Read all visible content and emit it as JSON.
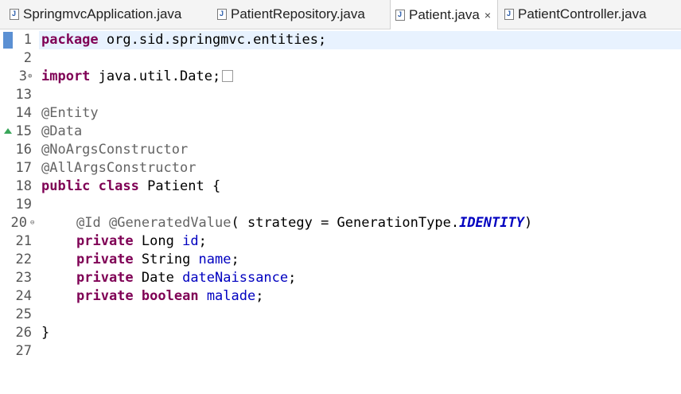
{
  "tabs": [
    {
      "label": "SpringmvcApplication.java",
      "active": false
    },
    {
      "label": "PatientRepository.java",
      "active": false
    },
    {
      "label": "Patient.java",
      "active": true
    },
    {
      "label": "PatientController.java",
      "active": false
    }
  ],
  "tab_close_glyph": "×",
  "icons": {
    "file": "java-file-icon",
    "close": "close-icon",
    "fold": "fold-toggle-icon",
    "warning": "warning-marker-icon"
  },
  "colors": {
    "keyword": "#7f0055",
    "annotation": "#646464",
    "field": "#0000c0",
    "current_line": "#e8f2fe"
  },
  "editor": {
    "line_numbers": [
      "1",
      "2",
      "3",
      "13",
      "14",
      "15",
      "16",
      "17",
      "18",
      "19",
      "20",
      "21",
      "22",
      "23",
      "24",
      "25",
      "26",
      "27"
    ],
    "lines": {
      "l1": {
        "kw": "package",
        "rest": " org.sid.springmvc.entities;"
      },
      "l3": {
        "kw": "import",
        "rest": " java.util.Date;"
      },
      "l14": {
        "ann": "@Entity"
      },
      "l15": {
        "ann": "@Data"
      },
      "l16": {
        "ann": "@NoArgsConstructor"
      },
      "l17": {
        "ann": "@AllArgsConstructor"
      },
      "l18": {
        "kw1": "public",
        "kw2": "class",
        "rest": " Patient {"
      },
      "l20": {
        "ann1": "@Id",
        "ann2": "@GeneratedValue",
        "rest": "( strategy = GenerationType.",
        "const": "IDENTITY",
        "end": ")"
      },
      "l21": {
        "kw": "private",
        "type": " Long ",
        "field": "id",
        "end": ";"
      },
      "l22": {
        "kw": "private",
        "type": " String ",
        "field": "name",
        "end": ";"
      },
      "l23": {
        "kw": "private",
        "type": " Date ",
        "field": "dateNaissance",
        "end": ";"
      },
      "l24": {
        "kw": "private",
        "type2": "boolean",
        "field": "malade",
        "end": ";"
      },
      "l26": {
        "rest": "}"
      }
    }
  }
}
